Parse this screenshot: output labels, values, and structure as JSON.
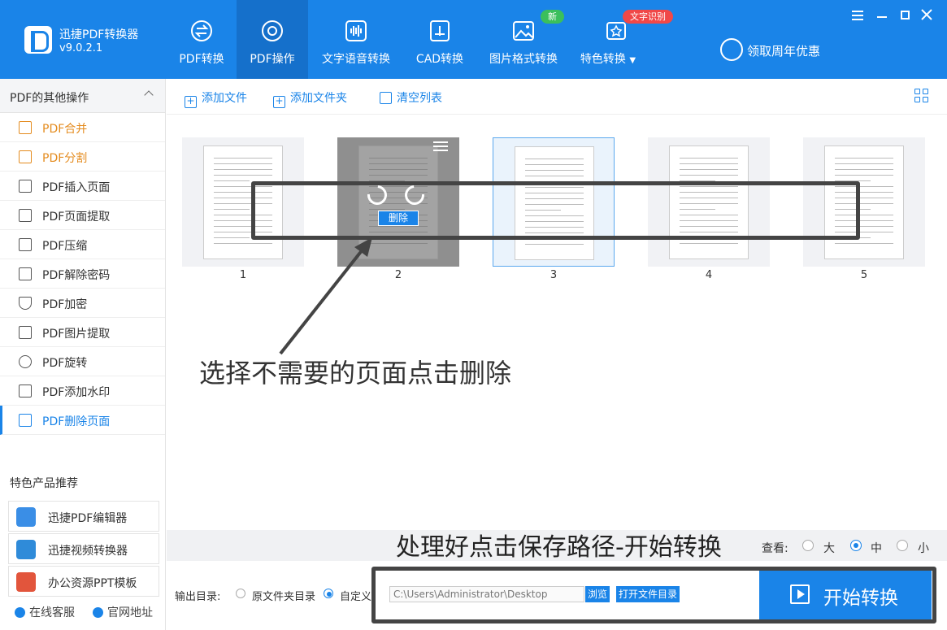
{
  "app": {
    "name": "迅捷PDF转换器",
    "version": "v9.0.2.1"
  },
  "header": {
    "tabs": [
      {
        "label": "PDF转换",
        "icon": "pdf-convert-icon"
      },
      {
        "label": "PDF操作",
        "icon": "pdf-operate-icon",
        "active": true
      },
      {
        "label": "文字语音转换",
        "icon": "audio-wave-icon"
      },
      {
        "label": "CAD转换",
        "icon": "cad-icon"
      },
      {
        "label": "图片格式转换",
        "icon": "image-icon",
        "badge": "新"
      },
      {
        "label": "特色转换",
        "icon": "star-icon",
        "badge": "文字识别"
      }
    ],
    "promo": "领取周年优惠",
    "colors": {
      "primary": "#1a84e8",
      "active_tab": "#1570cb",
      "badge_new": "#3bbf5c",
      "badge_ocr": "#f04848",
      "orange": "#e48b1e"
    }
  },
  "sidebar": {
    "title": "PDF的其他操作",
    "items": [
      {
        "label": "PDF合并",
        "icon": "merge-icon"
      },
      {
        "label": "PDF分割",
        "icon": "split-icon"
      },
      {
        "label": "PDF插入页面",
        "icon": "insert-page-icon"
      },
      {
        "label": "PDF页面提取",
        "icon": "extract-page-icon"
      },
      {
        "label": "PDF压缩",
        "icon": "compress-icon"
      },
      {
        "label": "PDF解除密码",
        "icon": "unlock-icon"
      },
      {
        "label": "PDF加密",
        "icon": "shield-icon"
      },
      {
        "label": "PDF图片提取",
        "icon": "image-extract-icon"
      },
      {
        "label": "PDF旋转",
        "icon": "rotate-icon"
      },
      {
        "label": "PDF添加水印",
        "icon": "watermark-icon"
      },
      {
        "label": "PDF删除页面",
        "icon": "delete-page-icon"
      }
    ],
    "recommend_title": "特色产品推荐",
    "recommend": [
      {
        "label": "迅捷PDF编辑器"
      },
      {
        "label": "迅捷视频转换器"
      },
      {
        "label": "办公资源PPT模板"
      }
    ],
    "footer": {
      "service": "在线客服",
      "website": "官网地址"
    }
  },
  "toolbar": {
    "add_file": "添加文件",
    "add_folder": "添加文件夹",
    "clear_list": "清空列表"
  },
  "pages": [
    {
      "num": "1"
    },
    {
      "num": "2"
    },
    {
      "num": "3"
    },
    {
      "num": "4"
    },
    {
      "num": "5"
    }
  ],
  "overlay": {
    "delete_label": "删除"
  },
  "annotations": {
    "delete_hint": "选择不需要的页面点击删除",
    "save_hint": "处理好点击保存路径-开始转换"
  },
  "view": {
    "label": "查看:",
    "options": [
      "大",
      "中",
      "小"
    ],
    "selected": "中"
  },
  "output": {
    "label": "输出目录:",
    "options": [
      "原文件夹目录",
      "自定义"
    ],
    "selected": "自定义",
    "path": "C:\\Users\\Administrator\\Desktop",
    "browse": "浏览",
    "open_folder": "打开文件目录"
  },
  "start_button": "开始转换"
}
